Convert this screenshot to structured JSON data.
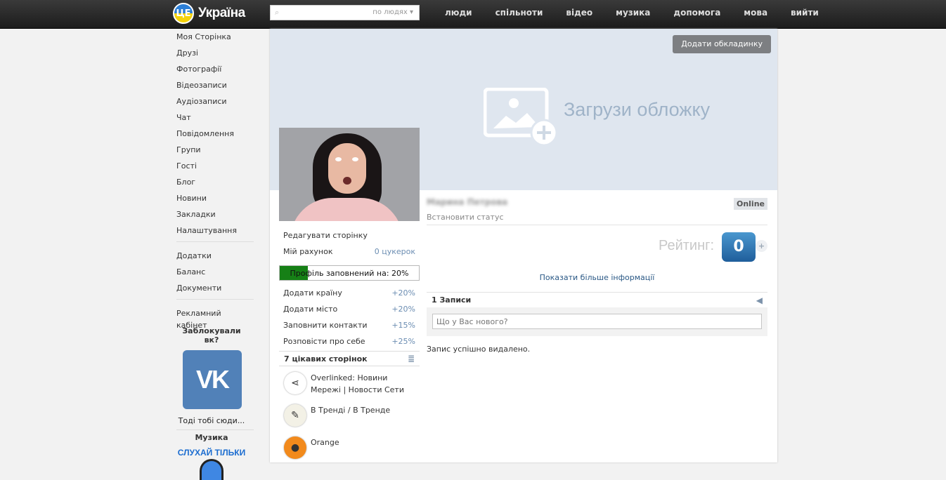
{
  "brand": {
    "badge": "ЦЕ",
    "name": "Україна"
  },
  "search": {
    "placeholder": "",
    "scope": "по людях ▾"
  },
  "nav": [
    "люди",
    "спільноти",
    "відео",
    "музика",
    "допомога",
    "мова",
    "вийти"
  ],
  "sidebar": {
    "items1": [
      "Моя Сторінка",
      "Друзі",
      "Фотографії",
      "Відеозаписи",
      "Аудіозаписи",
      "Чат",
      "Повідомлення",
      "Групи",
      "Гості",
      "Блог",
      "Новини",
      "Закладки",
      "Налаштування"
    ],
    "items2": [
      "Додатки",
      "Баланс",
      "Документи"
    ],
    "items3": [
      "Рекламний кабінет"
    ],
    "blocked_caption": "Заблокували вк?",
    "vk_logo": "VK",
    "vk_caption": "Тоді тобі сюди...",
    "music_caption": "Музика",
    "music_logo": "СЛУХАЙ ТІЛЬКИ"
  },
  "cover": {
    "button": "Додати обкладинку",
    "text": "Загрузи обложку"
  },
  "profile": {
    "edit": "Редагувати сторінку",
    "account": {
      "label": "Мій рахунок",
      "value": "0 цукерок"
    },
    "progress": {
      "text": "Профіль заповнений на: 20%",
      "percent": 20
    },
    "tasks": [
      {
        "label": "Додати країну",
        "value": "+20%"
      },
      {
        "label": "Додати місто",
        "value": "+20%"
      },
      {
        "label": "Заповнити контакти",
        "value": "+15%"
      },
      {
        "label": "Розповісти про себе",
        "value": "+25%"
      }
    ],
    "pages_title": "7 цікавих сторінок",
    "pages": [
      {
        "name": "Overlinked: Новини Мережі | Новости Сети",
        "color": "#ffffff",
        "glyph": "⋖"
      },
      {
        "name": "В Тренді / В Тренде",
        "color": "#f3f1e6",
        "glyph": "✎"
      },
      {
        "name": "Orange",
        "color": "#f28a1c",
        "glyph": "●"
      }
    ]
  },
  "user": {
    "name": "Марина Петрова",
    "online": "Online",
    "status": "Встановити статус",
    "rating_label": "Рейтинг:",
    "rating_value": "0",
    "rating_plus": "+",
    "more": "Показати більше інформації",
    "posts_title": "1 Записи",
    "post_placeholder": "Що у Вас нового?",
    "deleted_msg": "Запис успішно видалено."
  },
  "colors": {
    "topbar": "#1c1c1c",
    "cover": "#dfe6ef",
    "accent": "#2a5885",
    "progress": "#168016"
  }
}
